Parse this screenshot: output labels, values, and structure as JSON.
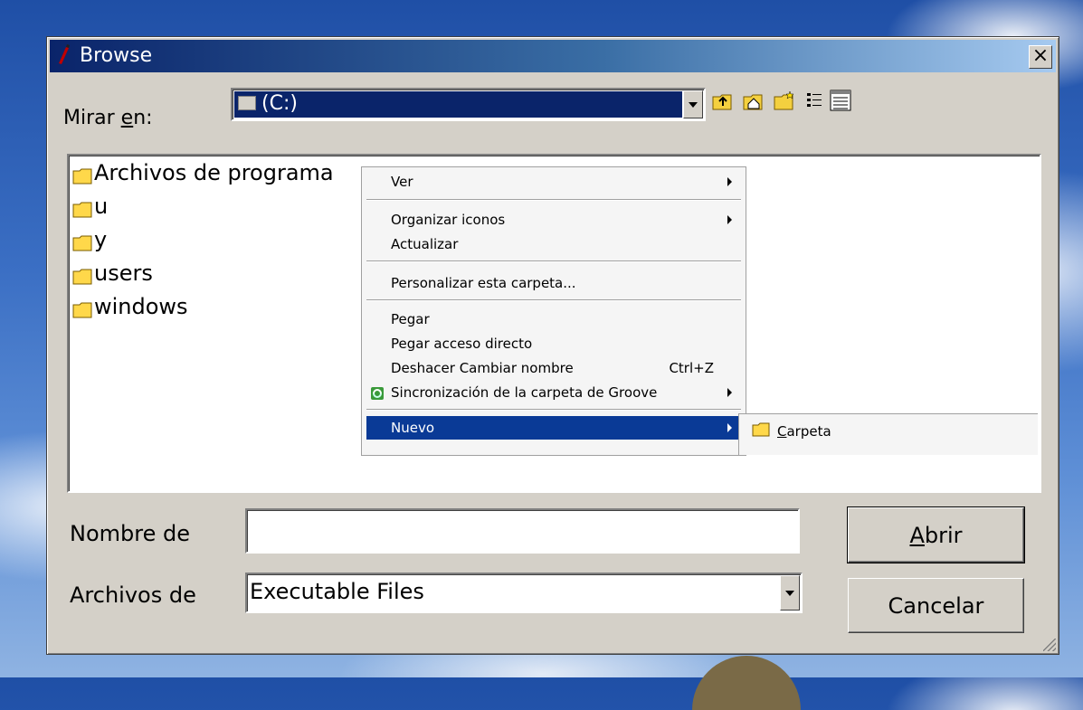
{
  "window": {
    "title": "Browse",
    "close_glyph": "×"
  },
  "look_in": {
    "label_prefix": "Mirar ",
    "label_underline": "e",
    "label_suffix": "n:",
    "value": "(C:)"
  },
  "toolbar": {
    "icons": [
      "up-folder-icon",
      "home-icon",
      "new-folder-icon",
      "list-view-icon",
      "details-view-icon"
    ]
  },
  "files": [
    {
      "name": "Archivos de programa"
    },
    {
      "name": "u"
    },
    {
      "name": "y"
    },
    {
      "name": "users"
    },
    {
      "name": "windows"
    }
  ],
  "context_menu": {
    "items": {
      "ver": "Ver",
      "organizar": "Organizar iconos",
      "actualizar": "Actualizar",
      "personalizar": "Personalizar esta carpeta...",
      "pegar": "Pegar",
      "pegar_acceso": "Pegar acceso directo",
      "deshacer": "Deshacer Cambiar nombre",
      "deshacer_shortcut": "Ctrl+Z",
      "groove": "Sincronización de la carpeta de Groove",
      "nuevo": "Nuevo"
    }
  },
  "submenu": {
    "carpeta_underline": "C",
    "carpeta_rest": "arpeta"
  },
  "filename": {
    "label": "Nombre de",
    "value": ""
  },
  "filetype": {
    "label": "Archivos de",
    "value": "Executable Files"
  },
  "buttons": {
    "open_underline": "A",
    "open_rest": "brir",
    "cancel": "Cancelar"
  }
}
